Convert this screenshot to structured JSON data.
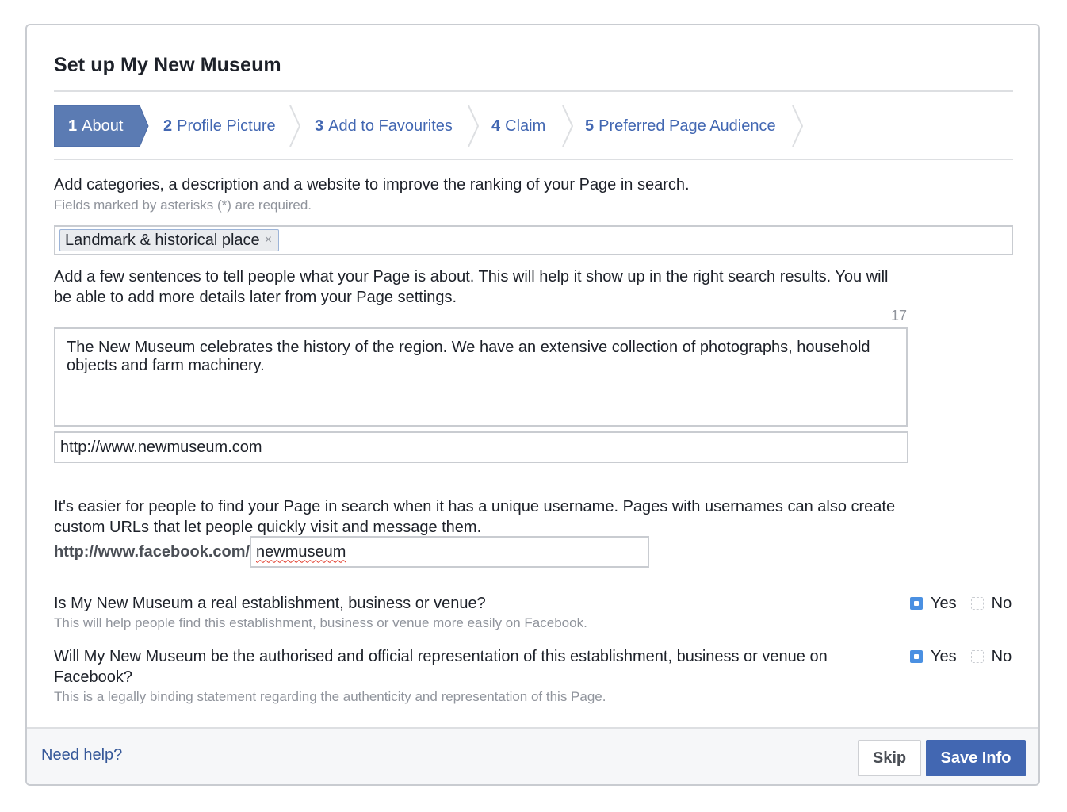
{
  "dialog": {
    "title": "Set up My New Museum"
  },
  "steps": [
    {
      "num": "1",
      "label": "About",
      "active": true
    },
    {
      "num": "2",
      "label": "Profile Picture",
      "active": false
    },
    {
      "num": "3",
      "label": "Add to Favourites",
      "active": false
    },
    {
      "num": "4",
      "label": "Claim",
      "active": false
    },
    {
      "num": "5",
      "label": "Preferred Page Audience",
      "active": false
    }
  ],
  "about": {
    "intro": "Add categories, a description and a website to improve the ranking of your Page in search.",
    "required_hint": "Fields marked by asterisks (*) are required.",
    "category_tag": "Landmark & historical place",
    "tag_remove": "×",
    "description_prompt": "Add a few sentences to tell people what your Page is about. This will help it show up in the right search results. You will be able to add more details later from your Page settings.",
    "char_counter": "17",
    "description_value": "The New Museum celebrates the history of the region. We have an extensive collection of photographs, household objects and farm machinery.",
    "website_value": "http://www.newmuseum.com",
    "username_prompt": "It's easier for people to find your Page in search when it has a unique username. Pages with usernames can also create custom URLs that let people quickly visit and message them.",
    "url_prefix": "http://www.facebook.com/",
    "username_value": "newmuseum"
  },
  "questions": [
    {
      "text": "Is My New Museum a real establishment, business or venue?",
      "hint": "This will help people find this establishment, business or venue more easily on Facebook.",
      "yes": "Yes",
      "no": "No",
      "selected": "Yes"
    },
    {
      "text": "Will My New Museum be the authorised and official representation of this establishment, business or venue on Facebook?",
      "hint": "This is a legally binding statement regarding the authenticity and representation of this Page.",
      "yes": "Yes",
      "no": "No",
      "selected": "Yes"
    }
  ],
  "footer": {
    "help": "Need help?",
    "skip": "Skip",
    "save": "Save Info"
  },
  "colors": {
    "accent": "#4267b2",
    "active_step": "#5b7bb3",
    "radio_on": "#4a90e2",
    "link": "#365899"
  }
}
